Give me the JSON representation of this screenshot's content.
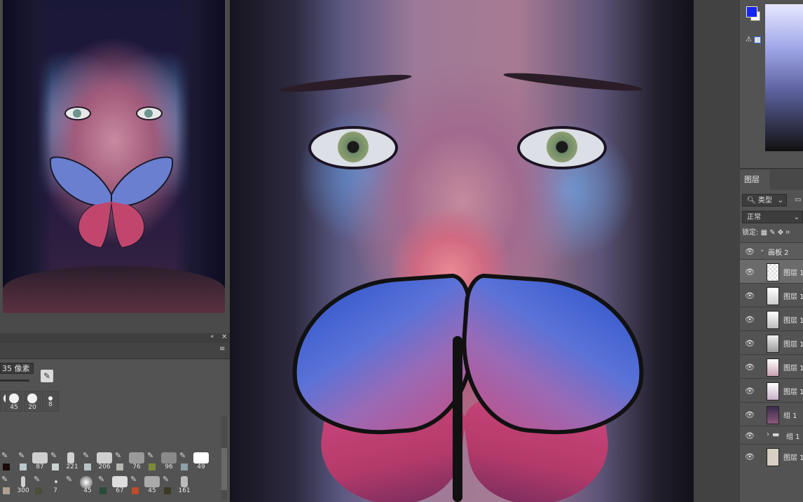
{
  "brush_panel": {
    "size_value": "35 像素",
    "presets": [
      {
        "num": ""
      },
      {
        "num": "45"
      },
      {
        "num": "20"
      },
      {
        "num": "8"
      }
    ],
    "brush_grid_rows": [
      [
        {
          "num": "",
          "swatch": "#1a0a0a"
        },
        {
          "num": "87",
          "swatch": "#b9c8cc"
        },
        {
          "num": "221",
          "swatch": "#c9d2d0"
        },
        {
          "num": "206",
          "swatch": "#b8c4c4"
        },
        {
          "num": "76",
          "swatch": "#b5b8b0"
        },
        {
          "num": "96",
          "swatch": "#7c8a3a"
        },
        {
          "num": "49",
          "swatch": "#8fa0a8"
        }
      ],
      [
        {
          "num": "300",
          "swatch": "#b0a090"
        },
        {
          "num": "7",
          "swatch": "#4a4e3a"
        },
        {
          "num": "45",
          "swatch": ""
        },
        {
          "num": "67",
          "swatch": "#2a4a3a"
        },
        {
          "num": "45",
          "swatch": "#c04a2a"
        },
        {
          "num": "161",
          "swatch": "#3a3a26"
        },
        {
          "num": "",
          "swatch": ""
        }
      ]
    ]
  },
  "color_panel": {
    "foreground": "#1426f0",
    "background": "#ffffff"
  },
  "layers_panel": {
    "tab_label": "图层",
    "filter_label": "类型",
    "blend_mode": "正常",
    "lock_label": "锁定:",
    "group_name": "画板 2",
    "layers": [
      {
        "name": "图层 1"
      },
      {
        "name": "图层 1"
      },
      {
        "name": "图层 1"
      },
      {
        "name": "图层 1"
      },
      {
        "name": "图层 1"
      },
      {
        "name": "图层 1"
      },
      {
        "name": "组 1"
      },
      {
        "name": "组 1"
      },
      {
        "name": "图层 1"
      }
    ]
  }
}
